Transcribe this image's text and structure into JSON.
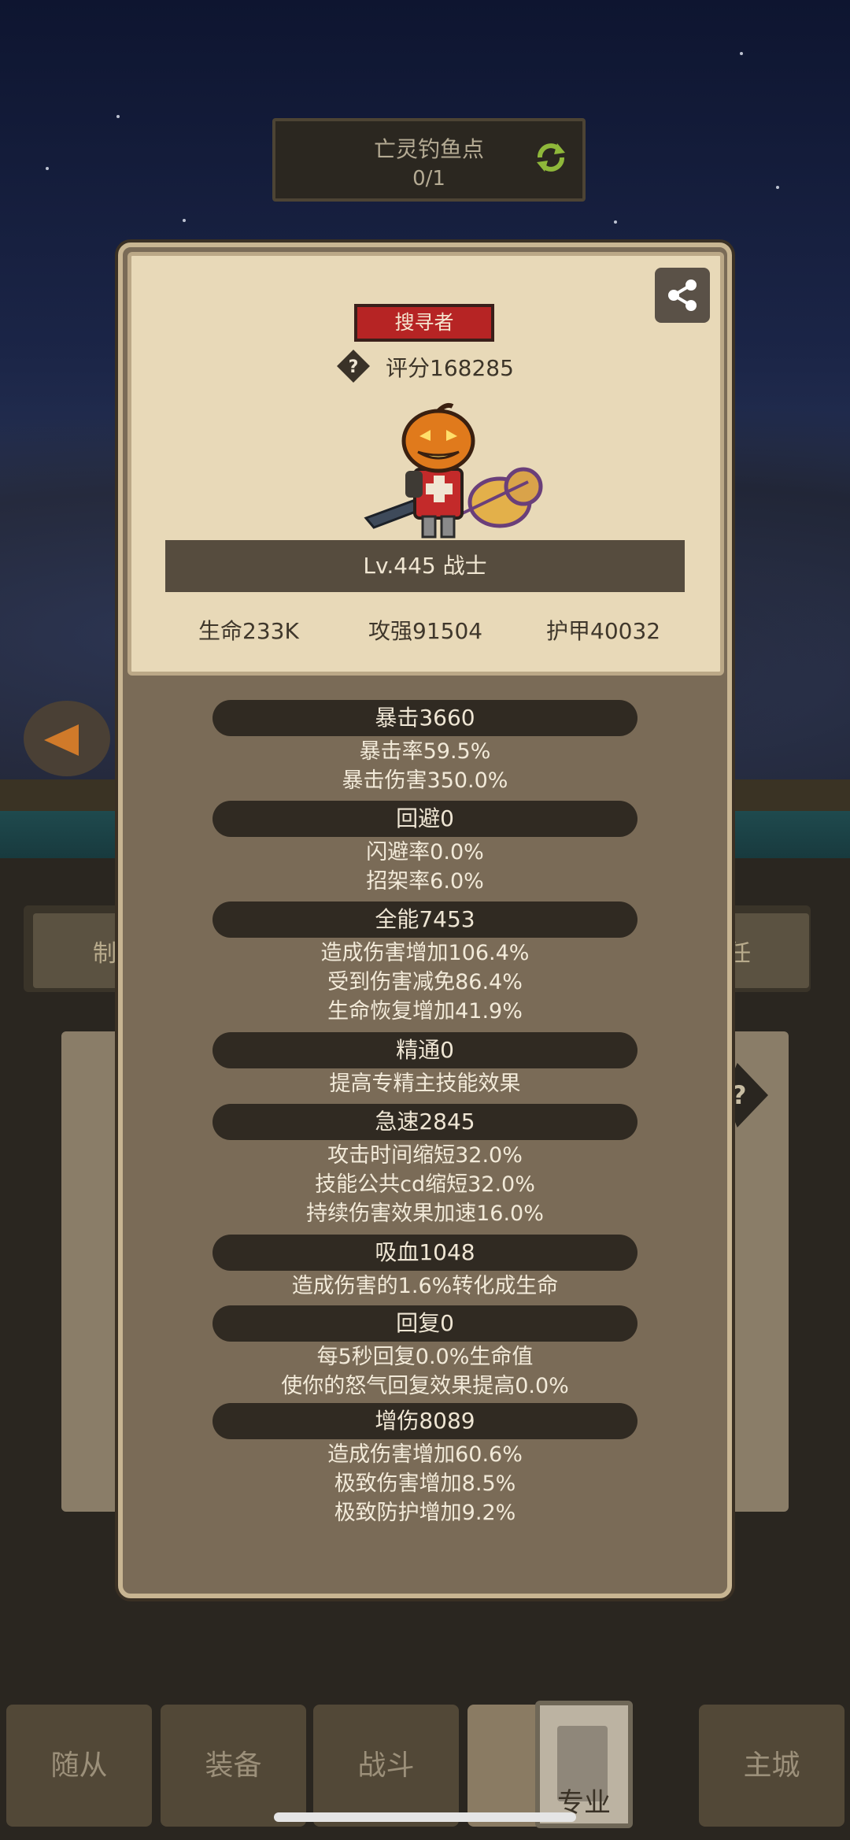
{
  "top_banner": {
    "title": "亡灵钓鱼点",
    "progress": "0/1",
    "icon": "refresh-icon"
  },
  "background_tabs": {
    "left_label": "制",
    "right_label": "任"
  },
  "dialog": {
    "badge": "搜寻者",
    "score_label": "评分168285",
    "level_text": "Lv.445 战士",
    "stats": [
      {
        "label": "生命233K"
      },
      {
        "label": "攻强91504"
      },
      {
        "label": "护甲40032"
      }
    ],
    "sections": [
      {
        "title": "暴击3660",
        "lines": [
          "暴击率59.5%",
          "暴击伤害350.0%"
        ]
      },
      {
        "title": "回避0",
        "lines": [
          "闪避率0.0%",
          "招架率6.0%"
        ]
      },
      {
        "title": "全能7453",
        "lines": [
          "造成伤害增加106.4%",
          "受到伤害减免86.4%",
          "生命恢复增加41.9%"
        ]
      },
      {
        "title": "精通0",
        "lines": [
          "提高专精主技能效果"
        ]
      },
      {
        "title": "急速2845",
        "lines": [
          "攻击时间缩短32.0%",
          "技能公共cd缩短32.0%",
          "持续伤害效果加速16.0%"
        ]
      },
      {
        "title": "吸血1048",
        "lines": [
          "造成伤害的1.6%转化成生命"
        ]
      },
      {
        "title": "回复0",
        "lines": [
          "每5秒回复0.0%生命值",
          "使你的怒气回复效果提高0.0%"
        ]
      },
      {
        "title": "增伤8089",
        "lines": [
          "造成伤害增加60.6%",
          "极致伤害增加8.5%",
          "极致防护增加9.2%"
        ]
      }
    ]
  },
  "bottom_nav": {
    "items": [
      {
        "label": "随从"
      },
      {
        "label": "装备"
      },
      {
        "label": "战斗"
      },
      {
        "label": "专业"
      },
      {
        "label": "主城"
      }
    ],
    "active_index": 3
  },
  "colors": {
    "badge_red": "#b62424",
    "panel_parchment": "#e8d9b8",
    "panel_body": "#7a6b57",
    "section_bar": "#302a22"
  }
}
